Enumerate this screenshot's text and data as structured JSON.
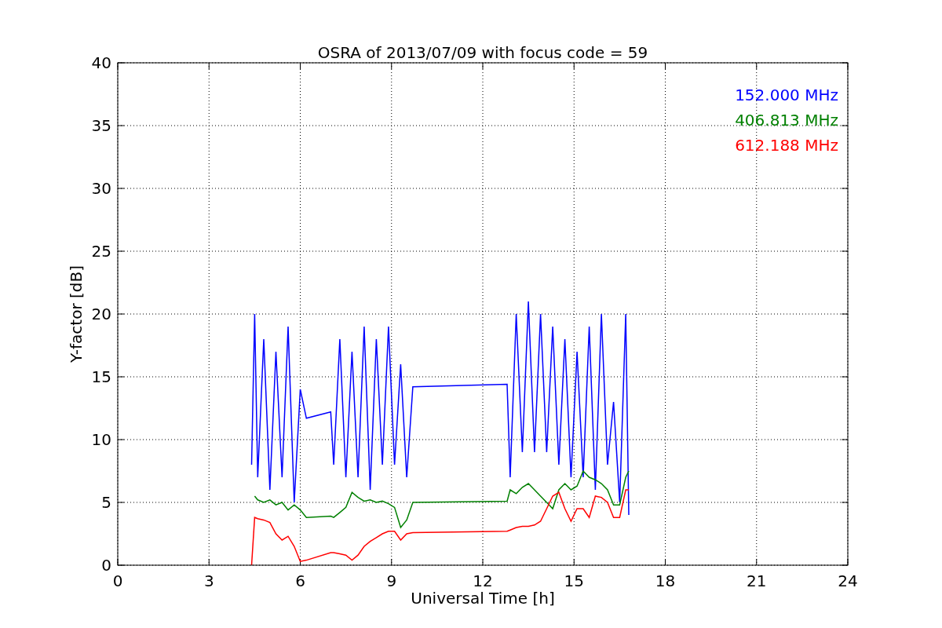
{
  "chart": {
    "chart_data": {
      "type": "line",
      "title": "OSRA of 2013/07/09 with focus code = 59",
      "xlabel": "Universal Time [h]",
      "ylabel": "Y-factor [dB]",
      "grid": true,
      "xlim": [
        0,
        24
      ],
      "ylim": [
        0,
        40
      ],
      "xticks": [
        0,
        3,
        6,
        9,
        12,
        15,
        18,
        21,
        24
      ],
      "yticks": [
        0,
        5,
        10,
        15,
        20,
        25,
        30,
        35,
        40
      ],
      "x": [
        4.4,
        4.5,
        4.6,
        4.8,
        5.0,
        5.2,
        5.4,
        5.6,
        5.8,
        6.0,
        6.2,
        7.0,
        7.1,
        7.3,
        7.5,
        7.7,
        7.9,
        8.1,
        8.3,
        8.5,
        8.7,
        8.9,
        9.1,
        9.3,
        9.5,
        9.7,
        12.8,
        12.9,
        13.1,
        13.3,
        13.5,
        13.7,
        13.9,
        14.1,
        14.3,
        14.5,
        14.7,
        14.9,
        15.1,
        15.3,
        15.5,
        15.7,
        15.9,
        16.1,
        16.3,
        16.5,
        16.7,
        16.8
      ],
      "series": [
        {
          "name": "152.000 MHz",
          "color": "#0000ff",
          "values": [
            8,
            20,
            7,
            18,
            6,
            17,
            7,
            19,
            5,
            14,
            11.7,
            12.2,
            8,
            18,
            7,
            17,
            7,
            19,
            6,
            18,
            8,
            19,
            8,
            16,
            7,
            14.2,
            14.4,
            7,
            20,
            9,
            21,
            9,
            20,
            9,
            19,
            8,
            18,
            7,
            17,
            7,
            19,
            6,
            20,
            8,
            13,
            5,
            20,
            4
          ]
        },
        {
          "name": "406.813 MHz",
          "color": "#008000",
          "values": [
            null,
            5.5,
            5.2,
            5.0,
            5.2,
            4.8,
            5.0,
            4.4,
            4.8,
            4.4,
            3.8,
            3.9,
            3.8,
            4.2,
            4.6,
            5.8,
            5.4,
            5.1,
            5.2,
            5.0,
            5.1,
            4.9,
            4.6,
            3.0,
            3.6,
            5.0,
            5.1,
            6.0,
            5.7,
            6.2,
            6.5,
            6.0,
            5.5,
            5.0,
            4.5,
            6.0,
            6.5,
            6.0,
            6.3,
            7.5,
            7.0,
            6.8,
            6.5,
            6.0,
            4.8,
            4.8,
            7.0,
            7.5
          ]
        },
        {
          "name": "612.188 MHz",
          "color": "#ff0000",
          "values": [
            0,
            3.8,
            3.7,
            3.6,
            3.4,
            2.5,
            2.0,
            2.3,
            1.5,
            0.3,
            0.4,
            1.0,
            1.0,
            0.9,
            0.8,
            0.4,
            0.8,
            1.5,
            1.9,
            2.2,
            2.5,
            2.7,
            2.7,
            2.0,
            2.5,
            2.6,
            2.7,
            2.8,
            3.0,
            3.1,
            3.1,
            3.2,
            3.5,
            4.5,
            5.5,
            5.8,
            4.5,
            3.5,
            4.5,
            4.5,
            3.8,
            5.5,
            5.4,
            5.0,
            3.8,
            3.8,
            6.0,
            6.0
          ]
        }
      ]
    }
  }
}
